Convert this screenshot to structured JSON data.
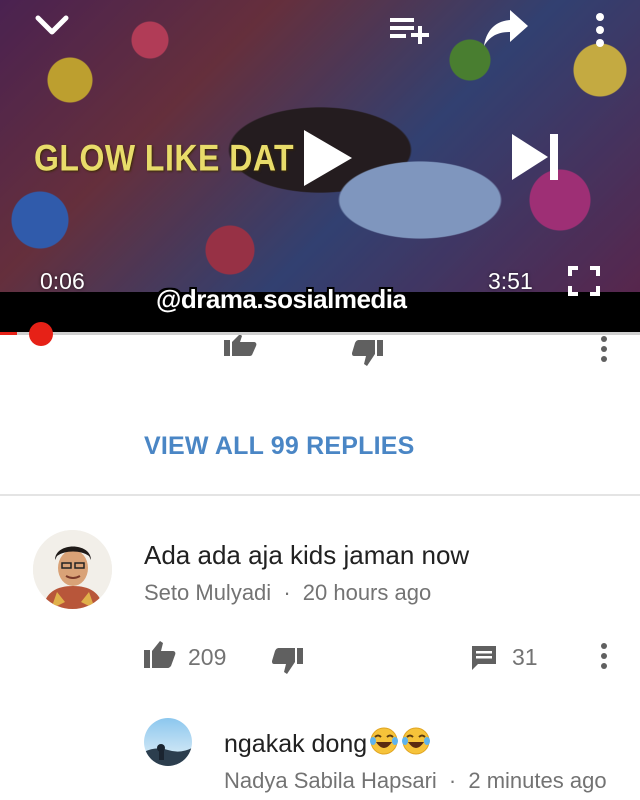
{
  "player": {
    "caption_text": "GLOW LIKE DAT",
    "current_time": "0:06",
    "total_time": "3:51",
    "watermark": "@drama.sosialmedia",
    "progress_fraction": 0.026,
    "accent_color": "#e62117",
    "icons": {
      "collapse": "chevron-down-icon",
      "playlist": "add-to-playlist-icon",
      "share": "share-icon",
      "more": "more-vert-icon",
      "play": "play-icon",
      "next": "skip-next-icon",
      "fullscreen": "fullscreen-icon"
    }
  },
  "previous_comment_actions": {
    "icons": {
      "like": "thumb-up-icon",
      "dislike": "thumb-down-icon",
      "more": "more-vert-icon"
    }
  },
  "replies_link": {
    "label": "VIEW ALL 99 REPLIES",
    "color": "#4a86c5"
  },
  "comment": {
    "text": "Ada ada aja kids jaman now",
    "author": "Seto Mulyadi",
    "separator": "·",
    "time": "20 hours ago",
    "likes": "209",
    "replies": "31",
    "icons": {
      "like": "thumb-up-icon",
      "dislike": "thumb-down-icon",
      "reply": "comment-icon",
      "more": "more-vert-icon"
    }
  },
  "reply": {
    "text": "ngakak dong",
    "emojis": "😂😂",
    "author": "Nadya Sabila Hapsari",
    "separator": "·",
    "time": "2 minutes ago"
  }
}
